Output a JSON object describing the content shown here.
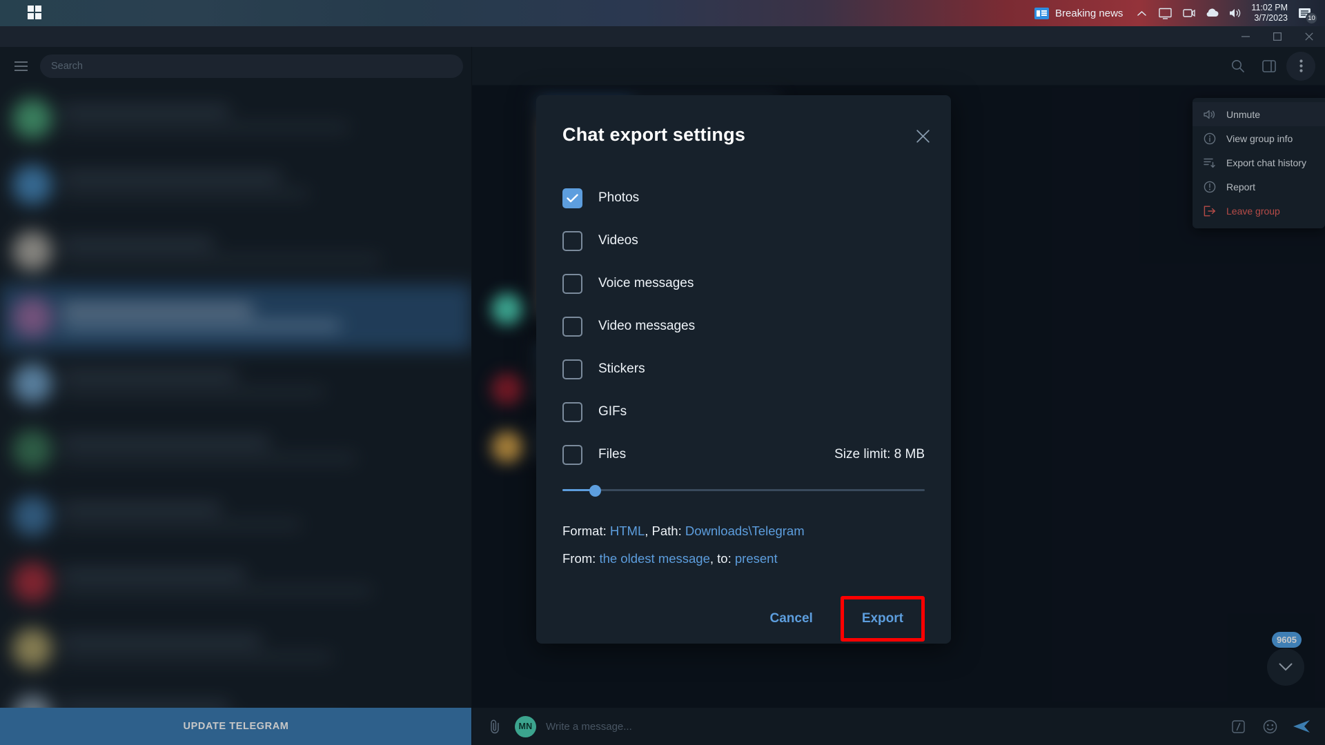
{
  "taskbar": {
    "start_icon": "windows-logo",
    "news_label": "Breaking news",
    "tray_icons": [
      "chevron-up-icon",
      "display-icon",
      "camera-icon",
      "cloud-icon",
      "volume-icon"
    ],
    "time": "11:02 PM",
    "date": "3/7/2023",
    "notification_count": "10"
  },
  "window": {
    "minimize": "minimize-icon",
    "maximize": "maximize-icon",
    "close": "close-icon"
  },
  "sidebar": {
    "menu_icon": "hamburger-icon",
    "search_placeholder": "Search",
    "update_banner": "UPDATE TELEGRAM"
  },
  "chat_header": {
    "icons": [
      "search-icon",
      "panel-icon",
      "more-vertical-icon"
    ]
  },
  "context_menu": {
    "items": [
      {
        "label": "Unmute",
        "icon": "speaker-muted-icon",
        "danger": false
      },
      {
        "label": "View group info",
        "icon": "info-circle-icon",
        "danger": false
      },
      {
        "label": "Export chat history",
        "icon": "export-list-icon",
        "danger": false
      },
      {
        "label": "Report",
        "icon": "alert-circle-icon",
        "danger": false
      },
      {
        "label": "Leave group",
        "icon": "leave-icon",
        "danger": true
      }
    ]
  },
  "modal": {
    "title": "Chat export settings",
    "close_icon": "close-icon",
    "options": [
      {
        "label": "Photos",
        "checked": true
      },
      {
        "label": "Videos",
        "checked": false
      },
      {
        "label": "Voice messages",
        "checked": false
      },
      {
        "label": "Video messages",
        "checked": false
      },
      {
        "label": "Stickers",
        "checked": false
      },
      {
        "label": "GIFs",
        "checked": false
      },
      {
        "label": "Files",
        "checked": false
      }
    ],
    "size_limit_label": "Size limit: 8 MB",
    "slider_percent": 9,
    "format_prefix": "Format: ",
    "format_value": "HTML",
    "path_prefix": ", Path: ",
    "path_value": "Downloads\\Telegram",
    "from_prefix": "From: ",
    "from_value": "the oldest message",
    "to_prefix": ", to: ",
    "to_value": "present",
    "cancel_label": "Cancel",
    "export_label": "Export",
    "highlight_color": "#ff0000"
  },
  "chat_footer": {
    "attach_icon": "paperclip-icon",
    "avatar_initials": "MN",
    "message_placeholder": "Write a message...",
    "command_icon": "slash-icon",
    "emoji_icon": "smiley-icon",
    "send_icon": "send-icon"
  },
  "scroll_button": {
    "unread_count": "9605",
    "icon": "chevron-down-icon"
  },
  "colors": {
    "accent": "#5d9ede",
    "danger": "#e8615c",
    "panel": "#17212b",
    "chat_bg": "#0e1621",
    "selected_row": "#2b5278",
    "banner": "#3c7cb2"
  }
}
